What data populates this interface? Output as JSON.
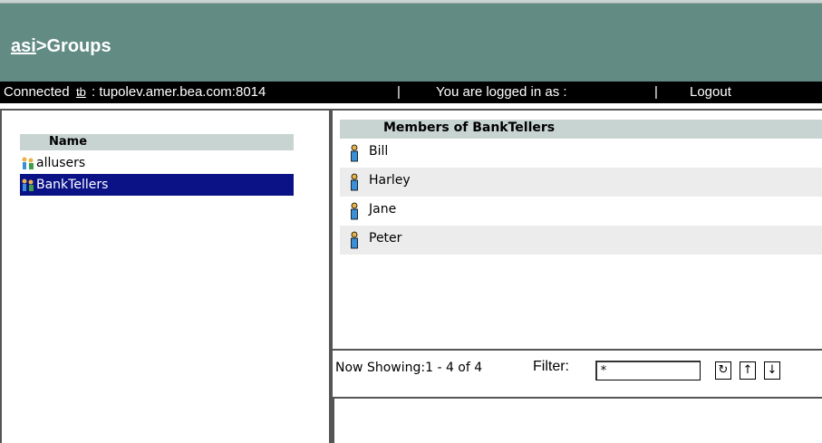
{
  "header": {
    "breadcrumb_root": "asi",
    "breadcrumb_current": ">Groups"
  },
  "status": {
    "connected_label": "Connected",
    "connection_icon": "plug-icon",
    "server": ": tupolev.amer.bea.com:8014",
    "separator": "|",
    "logged_in": "You are logged in as :",
    "logout": "Logout"
  },
  "groups": {
    "column_header": "Name",
    "items": [
      {
        "label": "allusers",
        "icon": "group-icon",
        "selected": false
      },
      {
        "label": "BankTellers",
        "icon": "group-icon",
        "selected": true
      }
    ]
  },
  "members": {
    "header": "Members of BankTellers",
    "items": [
      {
        "label": "Bill",
        "icon": "user-icon"
      },
      {
        "label": "Harley",
        "icon": "user-icon"
      },
      {
        "label": "Jane",
        "icon": "user-icon"
      },
      {
        "label": "Peter",
        "icon": "user-icon"
      }
    ]
  },
  "footer": {
    "now_showing": "Now Showing:1 - 4 of 4",
    "filter_label": "Filter:",
    "filter_value": "*",
    "buttons": [
      {
        "name": "refresh-button",
        "icon": "refresh-icon",
        "glyph": "↻"
      },
      {
        "name": "sort-ascending-button",
        "icon": "sort-up-icon",
        "glyph": "↑"
      },
      {
        "name": "sort-descending-button",
        "icon": "sort-down-icon",
        "glyph": "↓"
      }
    ]
  },
  "colors": {
    "header_bg": "#628b84",
    "status_bg": "#000000",
    "selection_bg": "#0a1286",
    "column_header_bg": "#c8d4d2",
    "alt_row_bg": "#ececec"
  }
}
